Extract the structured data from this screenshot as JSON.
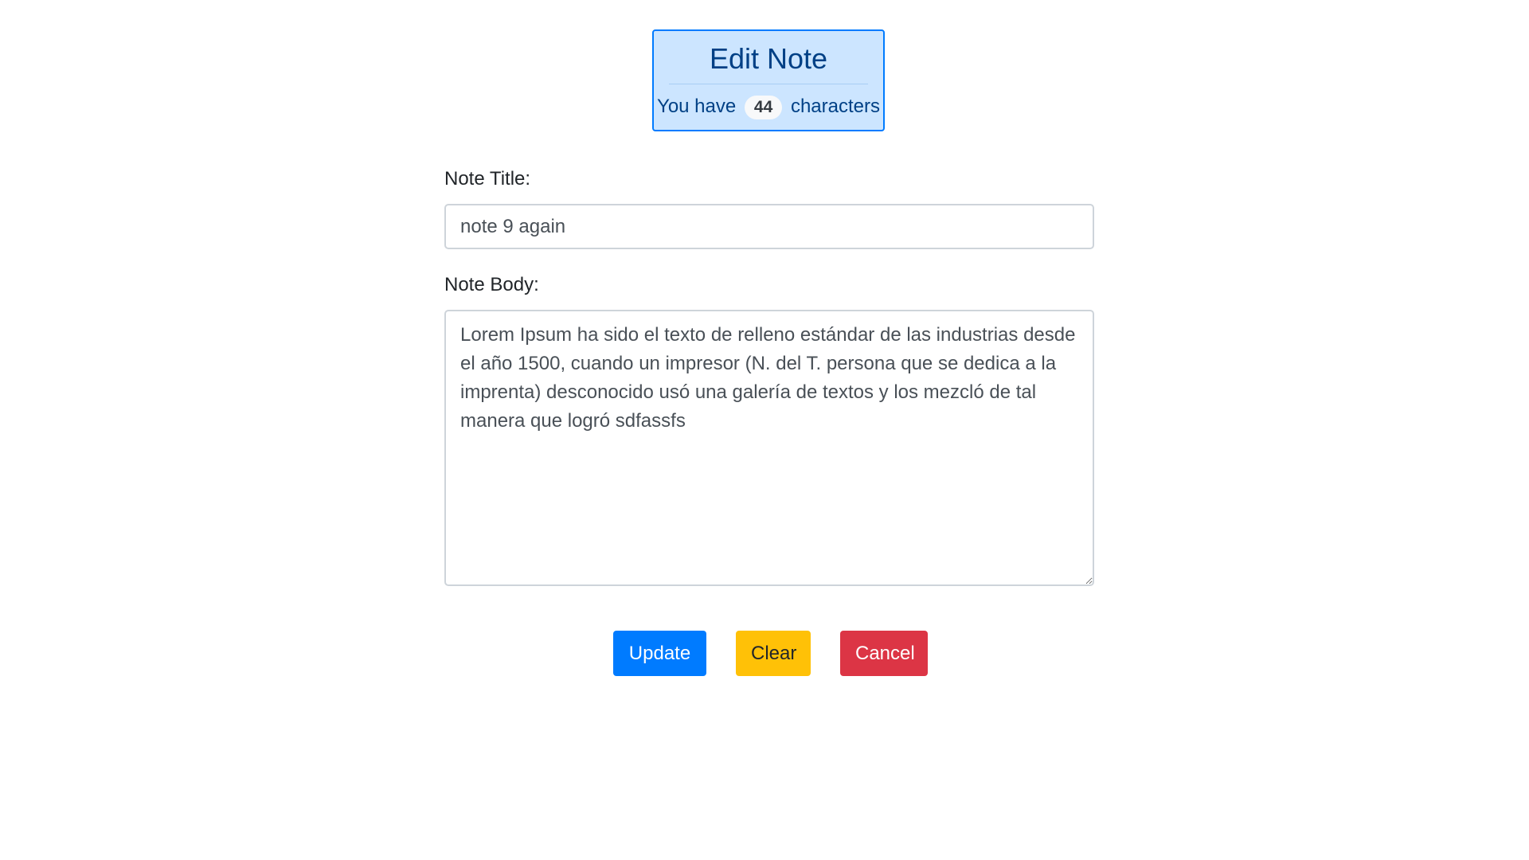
{
  "header": {
    "title": "Edit Note",
    "count_prefix": "You have",
    "count_value": "44",
    "count_suffix": "characters"
  },
  "form": {
    "title_label": "Note Title:",
    "title_value": "note 9 again",
    "body_label": "Note Body:",
    "body_value": "Lorem Ipsum ha sido el texto de relleno estándar de las industrias desde el año 1500, cuando un impresor (N. del T. persona que se dedica a la imprenta) desconocido usó una galería de textos y los mezcló de tal manera que logró sdfassfs"
  },
  "buttons": {
    "update": "Update",
    "clear": "Clear",
    "cancel": "Cancel"
  },
  "colors": {
    "header_bg": "#cce5ff",
    "header_border": "#007bff",
    "update_bg": "#007bff",
    "clear_bg": "#ffc107",
    "cancel_bg": "#dc3545"
  }
}
